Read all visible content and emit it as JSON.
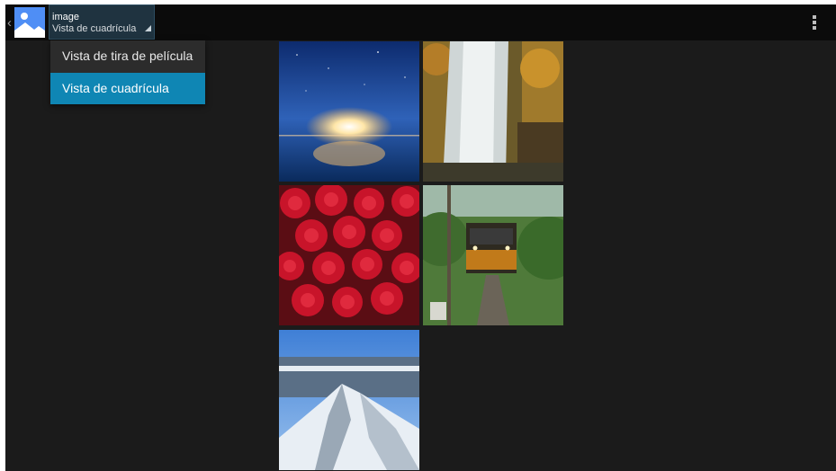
{
  "app": {
    "icon": "image-gallery-icon",
    "title": "image",
    "current_view": "Vista de cuadrícula"
  },
  "view_menu": {
    "items": [
      {
        "label": "Vista de tira de película",
        "selected": false
      },
      {
        "label": "Vista de cuadrícula",
        "selected": true
      }
    ]
  },
  "toolbar": {
    "overflow_icon": "more-vert-icon",
    "back_icon": "chevron-left-icon"
  },
  "grid": {
    "thumbnails": [
      {
        "subject": "starry-sky-sunrise"
      },
      {
        "subject": "autumn-waterfall"
      },
      {
        "subject": "red-roses"
      },
      {
        "subject": "train-in-forest"
      },
      {
        "subject": "snowy-mountain"
      }
    ]
  },
  "colors": {
    "background": "#1b1b1b",
    "actionbar": "#0b0b0b",
    "accent": "#0f86b4"
  }
}
